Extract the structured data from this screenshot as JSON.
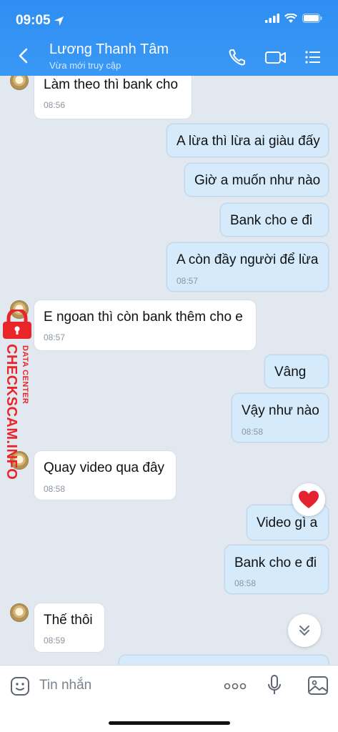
{
  "status": {
    "time": "09:05"
  },
  "header": {
    "title": "Lương Thanh Tâm",
    "subtitle": "Vừa mới truy cập"
  },
  "messages": [
    {
      "dir": "in",
      "text": "Làm theo thì bank cho",
      "time": "08:56"
    },
    {
      "dir": "out",
      "text": "A lừa thì lừa ai giàu đấy",
      "time": ""
    },
    {
      "dir": "out",
      "text": "Giờ a muốn như nào",
      "time": ""
    },
    {
      "dir": "out",
      "text": "Bank cho e đi",
      "time": ""
    },
    {
      "dir": "out",
      "text": "A còn đầy người để lừa",
      "time": "08:57"
    },
    {
      "dir": "in",
      "text": "E ngoan thì còn bank thêm cho e",
      "time": "08:57"
    },
    {
      "dir": "out",
      "text": "Vâng",
      "time": ""
    },
    {
      "dir": "out",
      "text": "Vậy như nào",
      "time": "08:58"
    },
    {
      "dir": "in",
      "text": "Quay video qua đây",
      "time": "08:58"
    },
    {
      "dir": "out",
      "text": "Video gì a",
      "time": ""
    },
    {
      "dir": "out",
      "text": "Bank cho e đi",
      "time": "08:58"
    },
    {
      "dir": "in",
      "text": "Thế thôi",
      "time": "08:59"
    }
  ],
  "watermark": {
    "line1": "DATA CENTER",
    "line2": "CHECKSCAM.INFO"
  },
  "input": {
    "placeholder": "Tin nhắn"
  },
  "colors": {
    "header": "#3a98f5",
    "outgoing": "#d5ebfc",
    "incoming": "#ffffff",
    "watermark": "#e8262a"
  }
}
